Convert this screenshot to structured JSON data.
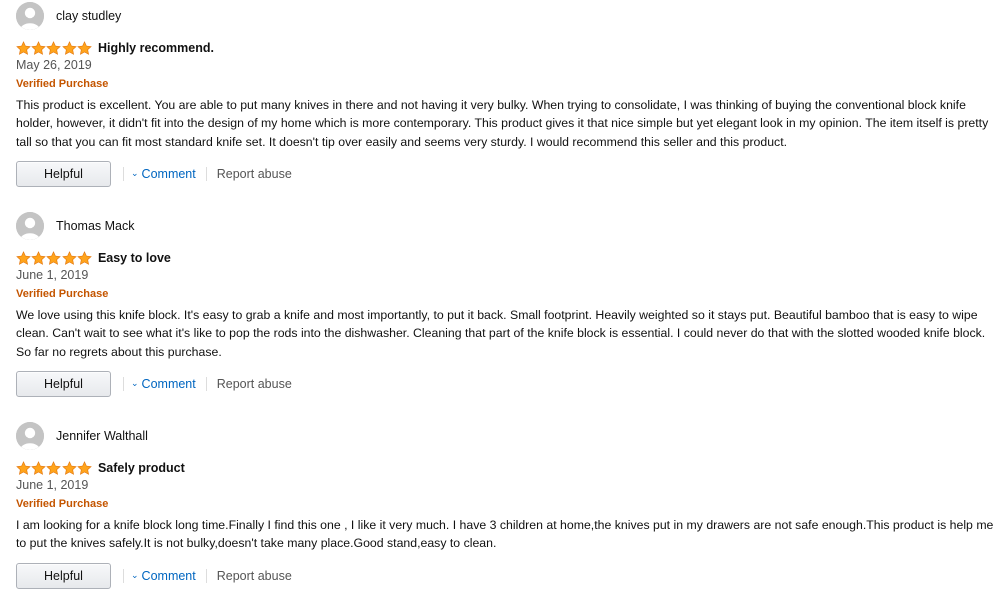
{
  "colors": {
    "star": "#ffa41c",
    "verified": "#c45500",
    "link": "#0066c0",
    "text": "#111111"
  },
  "reviews": [
    {
      "user": "clay studley",
      "rating": 5,
      "title": "Highly recommend.",
      "date": "May 26, 2019",
      "verified": "Verified Purchase",
      "body": "This product is excellent. You are able to put many knives in there and not having it very bulky. When trying to consolidate, I was thinking of buying the conventional block knife holder, however, it didn't fit into the design of my home which is more contemporary. This product gives it that nice simple but yet elegant look in my opinion. The item itself is pretty tall so that you can fit most standard knife set. It doesn't tip over easily and seems very sturdy. I would recommend this seller and this product.",
      "helpful": "Helpful",
      "comment": "Comment",
      "report": "Report abuse"
    },
    {
      "user": "Thomas Mack",
      "rating": 5,
      "title": "Easy to love",
      "date": "June 1, 2019",
      "verified": "Verified Purchase",
      "body": "We love using this knife block. It's easy to grab a knife and most importantly, to put it back. Small footprint. Heavily weighted so it stays put. Beautiful bamboo that is easy to wipe clean. Can't wait to see what it's like to pop the rods into the dishwasher. Cleaning that part of the knife block is essential. I could never do that with the slotted wooded knife block. So far no regrets about this purchase.",
      "helpful": "Helpful",
      "comment": "Comment",
      "report": "Report abuse"
    },
    {
      "user": "Jennifer Walthall",
      "rating": 5,
      "title": "Safely product",
      "date": "June 1, 2019",
      "verified": "Verified Purchase",
      "body": "I am looking for a knife block long time.Finally I find this one , I like it very much. I have 3 children at home,the knives put in my drawers are not safe enough.This product is help me to put the knives safely.It is not bulky,doesn't take many place.Good stand,easy to clean.",
      "helpful": "Helpful",
      "comment": "Comment",
      "report": "Report abuse"
    }
  ]
}
